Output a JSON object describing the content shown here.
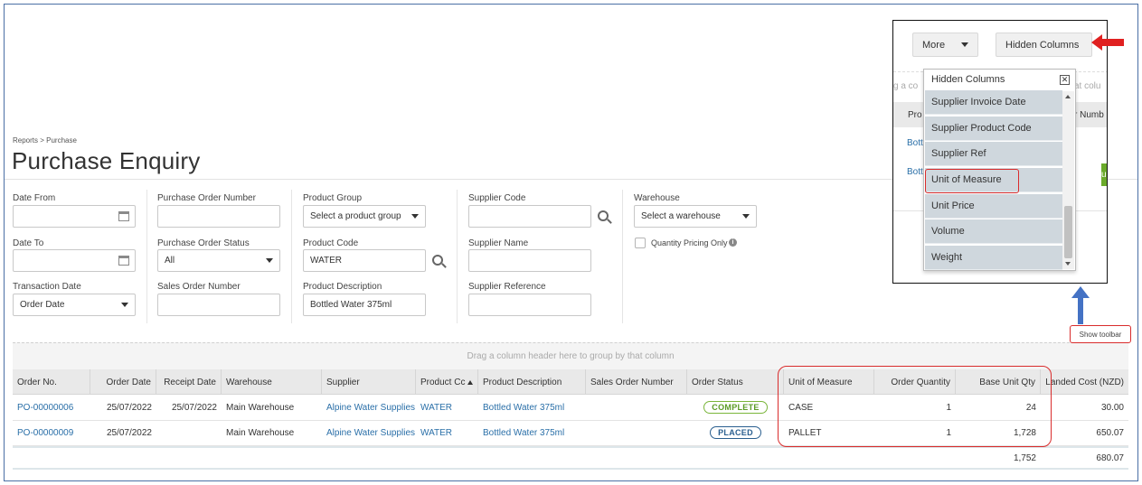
{
  "breadcrumb": "Reports > Purchase",
  "page_title": "Purchase Enquiry",
  "filters": {
    "date_from": {
      "label": "Date From",
      "value": ""
    },
    "date_to": {
      "label": "Date To",
      "value": ""
    },
    "transaction_date": {
      "label": "Transaction Date",
      "value": "Order Date"
    },
    "purchase_order_number": {
      "label": "Purchase Order Number",
      "value": ""
    },
    "purchase_order_status": {
      "label": "Purchase Order Status",
      "value": "All"
    },
    "sales_order_number": {
      "label": "Sales Order Number",
      "value": ""
    },
    "product_group": {
      "label": "Product Group",
      "value": "Select a product group"
    },
    "product_code": {
      "label": "Product Code",
      "value": "WATER"
    },
    "product_description": {
      "label": "Product Description",
      "value": "Bottled Water 375ml"
    },
    "supplier_code": {
      "label": "Supplier Code",
      "value": ""
    },
    "supplier_name": {
      "label": "Supplier Name",
      "value": ""
    },
    "supplier_reference": {
      "label": "Supplier Reference",
      "value": ""
    },
    "warehouse": {
      "label": "Warehouse",
      "value": "Select a warehouse"
    },
    "quantity_pricing_only": {
      "label": "Quantity Pricing Only",
      "checked": false
    }
  },
  "grid": {
    "group_hint": "Drag a column header here to group by that column",
    "columns": [
      "Order No.",
      "Order Date",
      "Receipt Date",
      "Warehouse",
      "Supplier",
      "Product Cc",
      "Product Description",
      "Sales Order Number",
      "Order Status",
      "Unit of Measure",
      "Order Quantity",
      "Base Unit Qty",
      "Landed Cost (NZD)"
    ],
    "rows": [
      {
        "order_no": "PO-00000006",
        "order_date": "25/07/2022",
        "receipt_date": "25/07/2022",
        "warehouse": "Main Warehouse",
        "supplier": "Alpine Water Supplies",
        "product_code": "WATER",
        "product_description": "Bottled Water 375ml",
        "sales_order_number": "",
        "status": "COMPLETE",
        "unit_of_measure": "CASE",
        "order_quantity": "1",
        "base_unit_qty": "24",
        "landed_cost": "30.00"
      },
      {
        "order_no": "PO-00000009",
        "order_date": "25/07/2022",
        "receipt_date": "",
        "warehouse": "Main Warehouse",
        "supplier": "Alpine Water Supplies",
        "product_code": "WATER",
        "product_description": "Bottled Water 375ml",
        "sales_order_number": "",
        "status": "PLACED",
        "unit_of_measure": "PALLET",
        "order_quantity": "1",
        "base_unit_qty": "1,728",
        "landed_cost": "650.07"
      }
    ],
    "totals": {
      "base_unit_qty": "1,752",
      "landed_cost": "680.07"
    }
  },
  "popout": {
    "more_label": "More",
    "hidden_columns_button": "Hidden Columns",
    "bg_text_drag": "g a co",
    "bg_text_by": "at colu",
    "bg_header_pro": "Pro",
    "bg_header_numb": "r Numb",
    "bg_link_1": "Bott",
    "bg_link_2": "Bott",
    "bg_button": "un",
    "panel_title": "Hidden Columns",
    "items": [
      "Supplier Invoice Date",
      "Supplier Product Code",
      "Supplier Ref",
      "Unit of Measure",
      "Unit Price",
      "Volume",
      "Weight"
    ]
  },
  "show_toolbar_label": "Show toolbar",
  "colors": {
    "accent_link": "#2a6fa8",
    "highlight": "#d92c2c",
    "complete": "#7ab53a",
    "placed": "#2a5f8f"
  }
}
